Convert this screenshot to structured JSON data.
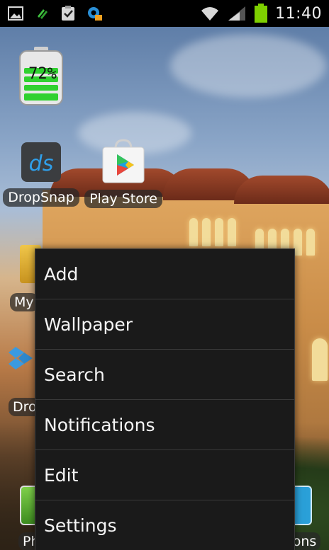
{
  "status_bar": {
    "time": "11:40",
    "icons_left": [
      "picture-icon",
      "sync-arrows-icon",
      "clipboard-check-icon",
      "gear-mail-icon"
    ],
    "icons_right": [
      "wifi-icon",
      "signal-icon",
      "battery-icon"
    ]
  },
  "battery_widget": {
    "percent_text": "72%",
    "level": 0.72
  },
  "apps": [
    {
      "label": "DropSnap",
      "icon": "dropsnap-icon"
    },
    {
      "label": "Play Store",
      "icon": "play-store-icon"
    }
  ],
  "partial_labels": {
    "my": "My",
    "dro": "Dro",
    "ph": "Ph",
    "tions": "tions"
  },
  "menu": {
    "items": [
      {
        "label": "Add"
      },
      {
        "label": "Wallpaper"
      },
      {
        "label": "Search"
      },
      {
        "label": "Notifications"
      },
      {
        "label": "Edit"
      },
      {
        "label": "Settings"
      }
    ]
  },
  "colors": {
    "menu_bg": "#1a1a1a",
    "battery_green": "#2fd12f",
    "status_battery": "#7ed000"
  }
}
